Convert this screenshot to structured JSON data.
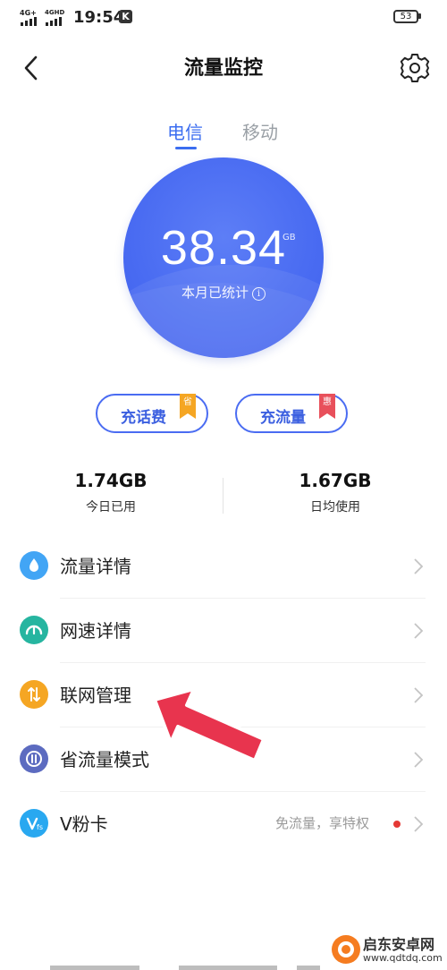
{
  "status_bar": {
    "network1_top": "4G+",
    "network2_top": "4GHD",
    "time": "19:54",
    "notify_letter": "K",
    "battery": "53"
  },
  "header": {
    "title": "流量监控",
    "back_icon": "back-arrow-icon",
    "settings_icon": "gear-icon"
  },
  "tabs": [
    {
      "label": "电信",
      "active": true
    },
    {
      "label": "移动",
      "active": false
    }
  ],
  "usage": {
    "value": "38.34",
    "unit": "GB",
    "label": "本月已统计",
    "info_glyph": "i"
  },
  "buttons": [
    {
      "label": "充话费",
      "tag": "省",
      "tag_color": "#f5a623"
    },
    {
      "label": "充流量",
      "tag": "惠",
      "tag_color": "#e8505b"
    }
  ],
  "stats": [
    {
      "value": "1.74GB",
      "label": "今日已用"
    },
    {
      "value": "1.67GB",
      "label": "日均使用"
    }
  ],
  "menu": [
    {
      "label": "流量详情",
      "icon": "droplet-icon",
      "color": "#42a5f5"
    },
    {
      "label": "网速详情",
      "icon": "speedometer-icon",
      "color": "#26b5a0"
    },
    {
      "label": "联网管理",
      "icon": "transfer-arrows-icon",
      "color": "#f5a623"
    },
    {
      "label": "省流量模式",
      "icon": "save-mode-icon",
      "color": "#5c6bc0"
    },
    {
      "label": "V粉卡",
      "icon": "vcard-icon",
      "color": "#29a8f0",
      "extra": "免流量，享特权"
    }
  ],
  "colors": {
    "accent": "#3b6df0",
    "annotation": "#e8344e"
  },
  "watermark": {
    "name": "启东安卓网",
    "url": "www.qdtdq.com"
  }
}
